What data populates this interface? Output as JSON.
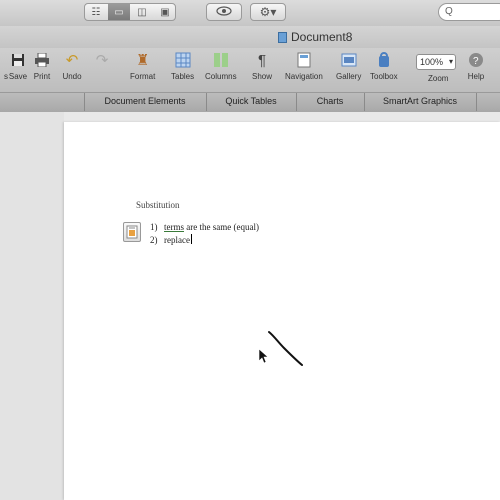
{
  "window": {
    "title": "Document8",
    "search_placeholder": "Q"
  },
  "view_buttons": [
    "draft-view-icon",
    "print-layout-icon",
    "notebook-view-icon",
    "publishing-view-icon"
  ],
  "toolbar": {
    "items": [
      {
        "label": "Save",
        "icon": "save-icon"
      },
      {
        "label": "Print",
        "icon": "print-icon"
      },
      {
        "label": "Undo",
        "icon": "undo-icon"
      },
      {
        "label": "Format",
        "icon": "format-brush-icon"
      },
      {
        "label": "Tables",
        "icon": "table-icon"
      },
      {
        "label": "Columns",
        "icon": "columns-icon"
      },
      {
        "label": "Show",
        "icon": "pilcrow-icon"
      },
      {
        "label": "Navigation",
        "icon": "navigation-icon"
      },
      {
        "label": "Gallery",
        "icon": "gallery-icon"
      },
      {
        "label": "Toolbox",
        "icon": "toolbox-icon"
      },
      {
        "label": "Zoom",
        "icon": "zoom-icon"
      },
      {
        "label": "Help",
        "icon": "help-icon"
      }
    ],
    "left_partial": "s",
    "zoom_value": "100%"
  },
  "ribbon": {
    "tabs": [
      "Document Elements",
      "Quick Tables",
      "Charts",
      "SmartArt Graphics"
    ]
  },
  "document": {
    "heading": "Substitution",
    "items": [
      {
        "number": "1)",
        "underlined": "terms",
        "text": " are the same (equal)"
      },
      {
        "number": "2)",
        "underlined": "",
        "text": "replace"
      }
    ]
  }
}
